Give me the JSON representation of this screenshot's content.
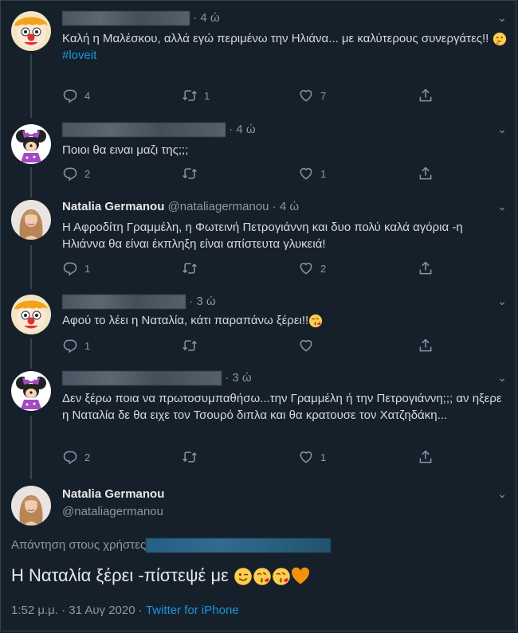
{
  "tweets": [
    {
      "time": "4 ώ",
      "text": "Καλή η Μαλέσκου, αλλά εγώ περιμένω την Ηλιάνα... με καλύτερους συνεργάτες!!",
      "hashtag": "#loveit",
      "replies": "4",
      "retweets": "1",
      "likes": "7"
    },
    {
      "time": "4 ώ",
      "text": "Ποιοι θα ειναι μαζι της;;;",
      "replies": "2",
      "retweets": "",
      "likes": "1"
    },
    {
      "name": "Natalia Germanou",
      "handle": "@nataliagermanou",
      "time": "4 ώ",
      "text": "Η Αφροδίτη Γραμμέλη, η Φωτεινή Πετρογιάννη και δυο πολύ καλά αγόρια -η Ηλιάννα θα είναι έκπληξη είναι απίστευτα γλυκειά!",
      "replies": "1",
      "retweets": "",
      "likes": "2"
    },
    {
      "time": "3 ώ",
      "text": "Αφού το λέει η Ναταλία, κάτι παραπάνω ξέρει!!",
      "replies": "1",
      "retweets": "",
      "likes": ""
    },
    {
      "time": "3 ώ",
      "text": "Δεν ξέρω ποια να πρωτοσυμπαθήσω...την Γραμμέλη ή την Πετρογιάννη;;; αν ηξερε η Ναταλία δε θα ειχε τον Τσουρό διπλα και θα κρατουσε τον Χατζηδάκη...",
      "replies": "2",
      "retweets": "",
      "likes": "1"
    }
  ],
  "main": {
    "name": "Natalia Germanou",
    "handle": "@nataliagermanou",
    "reply_label": "Απάντηση στους χρήστες",
    "text": "Η Ναταλία ξέρει -πίστεψέ με",
    "time": "1:52 μ.μ. · 31 Αυγ 2020 · ",
    "source": "Twitter for iPhone"
  },
  "colors": {
    "bg": "#15202b",
    "link": "#1b95e0",
    "muted": "#8899a6",
    "border": "#38444d"
  },
  "icons": [
    "reply-icon",
    "retweet-icon",
    "like-icon",
    "share-icon",
    "chevron-down-icon",
    "thinking-face-emoji",
    "kissing-face-emoji",
    "winking-face-emoji",
    "orange-heart-emoji"
  ]
}
